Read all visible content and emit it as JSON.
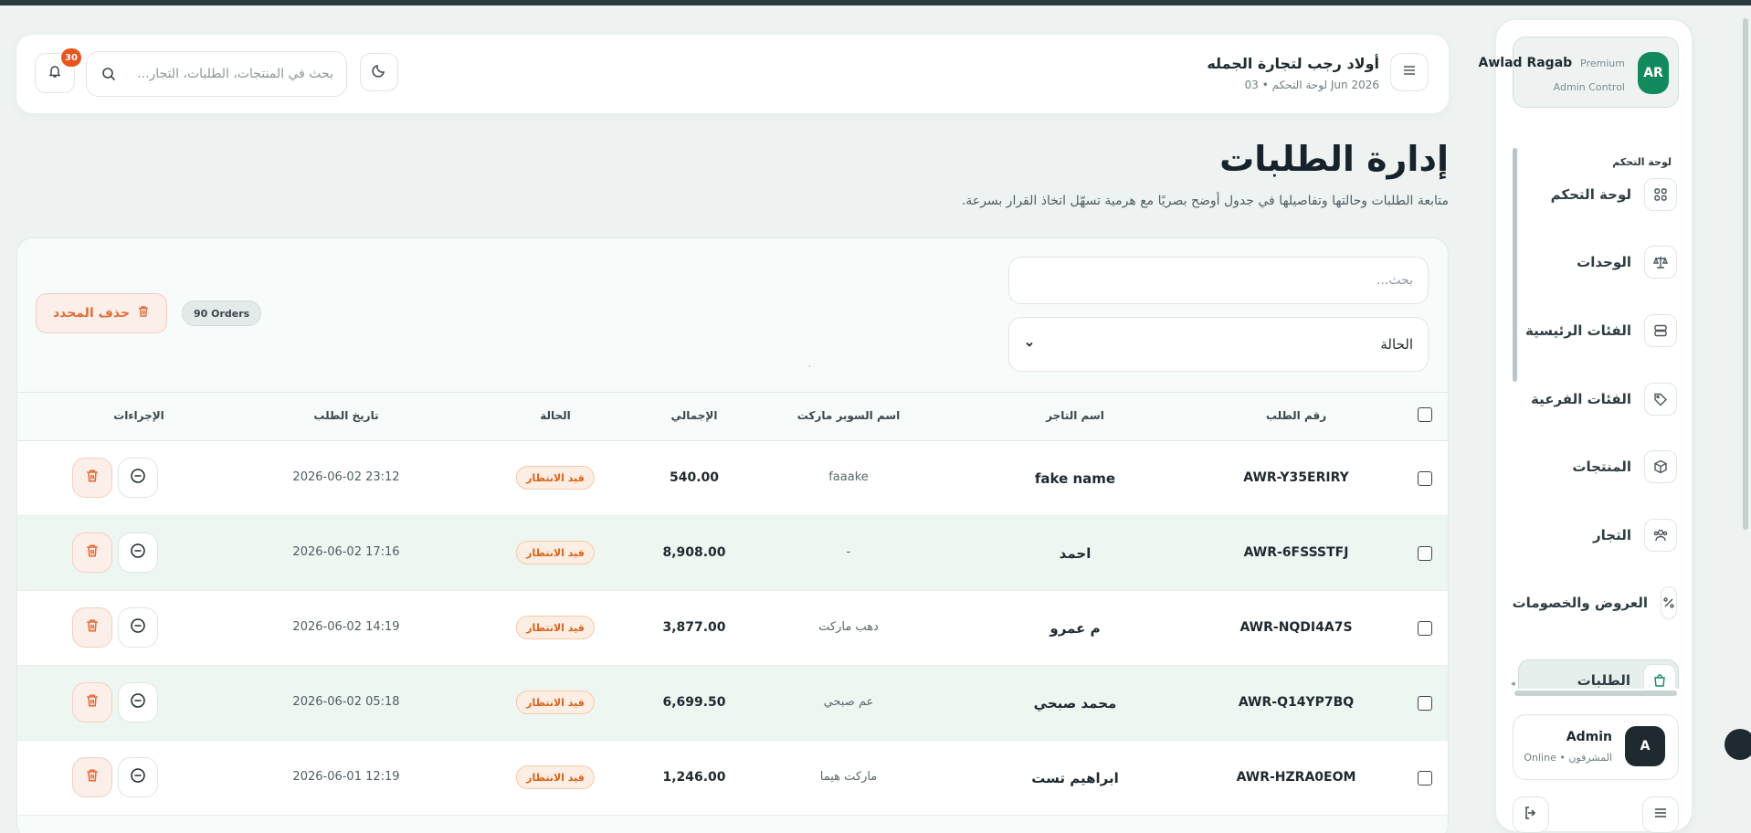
{
  "header": {
    "brand_title": "أولاد رجب لتجارة الجمله",
    "brand_subtitle": "لوحة التحكم • 03 Jun 2026",
    "search_placeholder": "بحث في المنتجات، الطلبات، التجار...",
    "notifications_count": "30"
  },
  "profile": {
    "avatar_initials": "AR",
    "name": "Awlad Ragab",
    "tier": "Premium",
    "role": "Admin Control"
  },
  "sidebar": {
    "section_label": "لوحة التحكم",
    "items": [
      {
        "label": "لوحة التحكم",
        "icon": "grid-icon"
      },
      {
        "label": "الوحدات",
        "icon": "scale-icon"
      },
      {
        "label": "الفئات الرئيسية",
        "icon": "layers-icon"
      },
      {
        "label": "الفئات الفرعية",
        "icon": "tag-icon"
      },
      {
        "label": "المنتجات",
        "icon": "box-icon"
      },
      {
        "label": "التجار",
        "icon": "users-icon"
      },
      {
        "label": "العروض والخصومات",
        "icon": "percent-icon"
      },
      {
        "label": "الطلبات",
        "icon": "bag-icon"
      }
    ]
  },
  "admin": {
    "avatar_initial": "A",
    "name": "Admin",
    "status": "Online • المشرفون"
  },
  "page": {
    "title": "إدارة الطلبات",
    "subtitle": "متابعة الطلبات وحالتها وتفاصيلها في جدول أوضح بصريًا مع هرمية تسهّل اتخاذ القرار بسرعة."
  },
  "filters": {
    "search_placeholder": "بحث...",
    "status_label": "الحالة",
    "delete_selected": "حذف المحدد",
    "orders_count": "90 Orders"
  },
  "table": {
    "columns": {
      "order_id": "رقم الطلب",
      "merchant": "اسم التاجر",
      "market": "اسم السوبر ماركت",
      "total": "الإجمالي",
      "status": "الحالة",
      "date": "تاريخ الطلب",
      "actions": "الإجراءات"
    },
    "rows": [
      {
        "order_id": "AWR-Y35ERIRY",
        "merchant": "fake name",
        "market": "faaake",
        "total": "540.00",
        "status": "قيد الانتظار",
        "date": "2026-06-02 23:12"
      },
      {
        "order_id": "AWR-6FSSSTFJ",
        "merchant": "احمد",
        "market": "-",
        "total": "8,908.00",
        "status": "قيد الانتظار",
        "date": "2026-06-02 17:16"
      },
      {
        "order_id": "AWR-NQDI4A7S",
        "merchant": "م عمرو",
        "market": "دهب ماركت",
        "total": "3,877.00",
        "status": "قيد الانتظار",
        "date": "2026-06-02 14:19"
      },
      {
        "order_id": "AWR-Q14YP7BQ",
        "merchant": "محمد صبحي",
        "market": "عم صبحي",
        "total": "6,699.50",
        "status": "قيد الانتظار",
        "date": "2026-06-02 05:18"
      },
      {
        "order_id": "AWR-HZRA0EOM",
        "merchant": "ابراهيم تست",
        "market": "ماركت هيما",
        "total": "1,246.00",
        "status": "قيد الانتظار",
        "date": "2026-06-01 12:19"
      }
    ]
  },
  "colors": {
    "brand_green": "#138a5e",
    "danger_orange": "#e26d3b",
    "pending_badge": "#d9621c",
    "notification_badge": "#e8541d"
  }
}
